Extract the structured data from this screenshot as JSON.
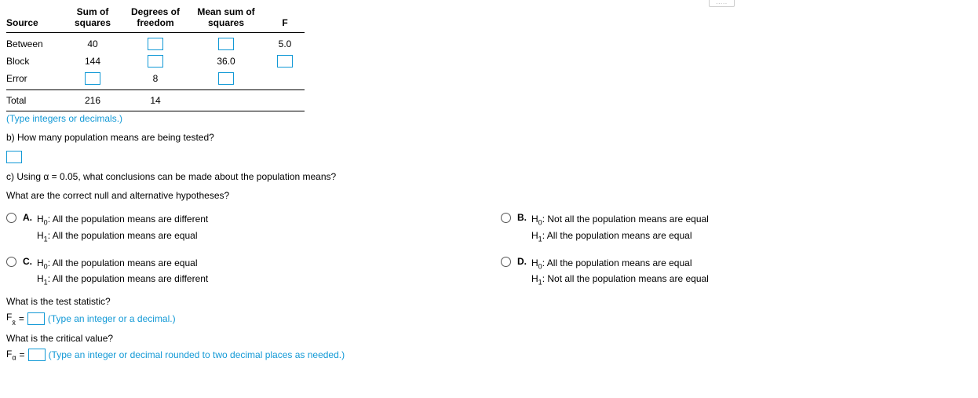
{
  "dots": ".....",
  "table": {
    "headers": {
      "c1": "Source",
      "c2a": "Sum of",
      "c2b": "squares",
      "c3a": "Degrees of",
      "c3b": "freedom",
      "c4a": "Mean sum of",
      "c4b": "squares",
      "c5": "F"
    },
    "rows": {
      "between": {
        "label": "Between",
        "ss": "40",
        "f": "5.0"
      },
      "block": {
        "label": "Block",
        "ss": "144",
        "ms": "36.0"
      },
      "error": {
        "label": "Error",
        "df": "8"
      },
      "total": {
        "label": "Total",
        "ss": "216",
        "df": "14"
      }
    }
  },
  "hints": {
    "type1": "(Type integers or decimals.)",
    "type2": "(Type an integer or a decimal.)",
    "type3": "(Type an integer or decimal rounded to two decimal places as needed.)"
  },
  "questions": {
    "b": "b) How many population means are being tested?",
    "c": "c) Using α = 0.05, what conclusions can be made about the population means?",
    "hyp": "What are the correct null and alternative hypotheses?",
    "ts": "What is the test statistic?",
    "cv": "What is the critical value?"
  },
  "options": {
    "A": {
      "letter": "A.",
      "h0": "H",
      "h0sub": "0",
      "h0txt": ": All the population means are different",
      "h1": "H",
      "h1sub": "1",
      "h1txt": ": All the population means are equal"
    },
    "B": {
      "letter": "B.",
      "h0": "H",
      "h0sub": "0",
      "h0txt": ": Not all the population means are equal",
      "h1": "H",
      "h1sub": "1",
      "h1txt": ": All the population means are equal"
    },
    "C": {
      "letter": "C.",
      "h0": "H",
      "h0sub": "0",
      "h0txt": ": All the population means are equal",
      "h1": "H",
      "h1sub": "1",
      "h1txt": ": All the population means are different"
    },
    "D": {
      "letter": "D.",
      "h0": "H",
      "h0sub": "0",
      "h0txt": ": All the population means are equal",
      "h1": "H",
      "h1sub": "1",
      "h1txt": ": Not all the population means are equal"
    }
  },
  "formula": {
    "fx_left": "F",
    "fx_sub": "x",
    "fx_eq": " = ",
    "fa_left": "F",
    "fa_sub": "α",
    "fa_eq": " = "
  }
}
